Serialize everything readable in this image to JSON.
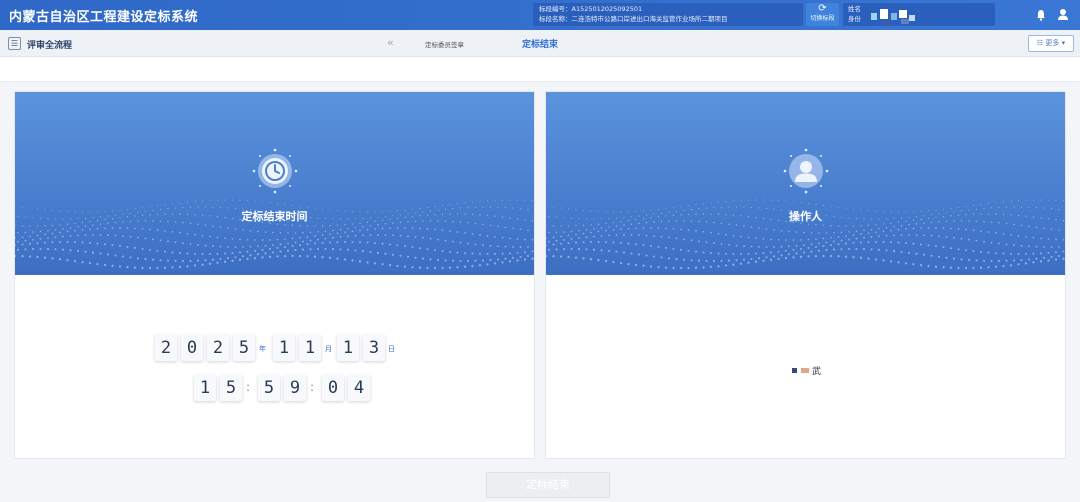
{
  "header": {
    "app_title": "内蒙古自治区工程建设定标系统",
    "project_code_label": "标段编号：A15250120250925​01",
    "project_name_label": "标段名称：二连浩特市公路口岸进出口海关监管作业场所二期项目",
    "switch_label": "切换标段",
    "user_line1": "姓名",
    "user_line2": "身份"
  },
  "subbar": {
    "flow_label": "评审全流程",
    "prev_arrow": "«",
    "step_prev": "定标委员签章",
    "step_current": "定标结束",
    "more_label": "☷ 更多 ▾"
  },
  "left_panel": {
    "title": "定标结束时间",
    "date_digits": [
      "2",
      "0",
      "2",
      "5",
      "1",
      "1",
      "1",
      "3"
    ],
    "date_units": {
      "year": "年",
      "month": "月",
      "day": "日"
    },
    "time_digits": [
      "1",
      "5",
      "5",
      "9",
      "0",
      "4"
    ],
    "colon": ":"
  },
  "right_panel": {
    "title": "操作人",
    "operator_name": "武"
  },
  "footer": {
    "finish_button": "定标结束"
  },
  "colors": {
    "header_bg": "#2f68c6",
    "accent": "#2f6fd6",
    "banner": "#4a7fcf"
  }
}
